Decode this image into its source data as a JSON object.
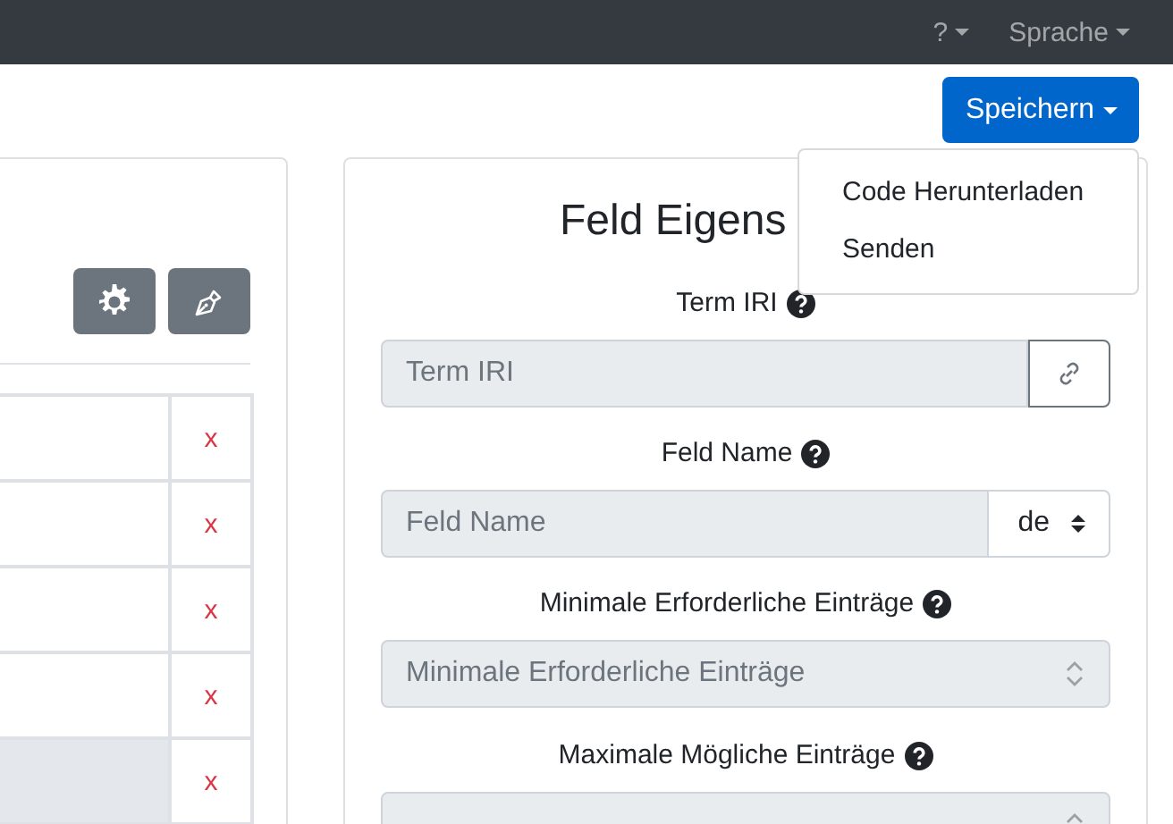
{
  "navbar": {
    "items": [
      {
        "label": "?",
        "kind": "dropdown"
      },
      {
        "label": "Sprache",
        "kind": "dropdown"
      }
    ]
  },
  "save_menu": {
    "label": "Speichern",
    "expanded": true,
    "items": [
      "Code Herunterladen",
      "Senden"
    ]
  },
  "left_panel": {
    "toolbar": [
      {
        "kind": "settings"
      },
      {
        "kind": "pen"
      }
    ],
    "rows": [
      {
        "delete": "x",
        "highlighted": false
      },
      {
        "delete": "x",
        "highlighted": false
      },
      {
        "delete": "x",
        "highlighted": false
      },
      {
        "delete": "x",
        "highlighted": false
      },
      {
        "delete": "x",
        "highlighted": true
      }
    ]
  },
  "properties_panel": {
    "title": "Feld Eigens",
    "fields": [
      {
        "label": "Term IRI",
        "placeholder": "Term IRI",
        "kind": "link",
        "disabled": true
      },
      {
        "label": "Feld Name",
        "placeholder": "Feld Name",
        "kind": "language",
        "addon": "de",
        "disabled": true
      },
      {
        "label": "Minimale Erforderliche Einträge",
        "placeholder": "Minimale Erforderliche Einträge",
        "kind": "number",
        "disabled": true
      },
      {
        "label": "Maximale Mögliche Einträge",
        "kind": "number",
        "disabled": true
      }
    ]
  }
}
